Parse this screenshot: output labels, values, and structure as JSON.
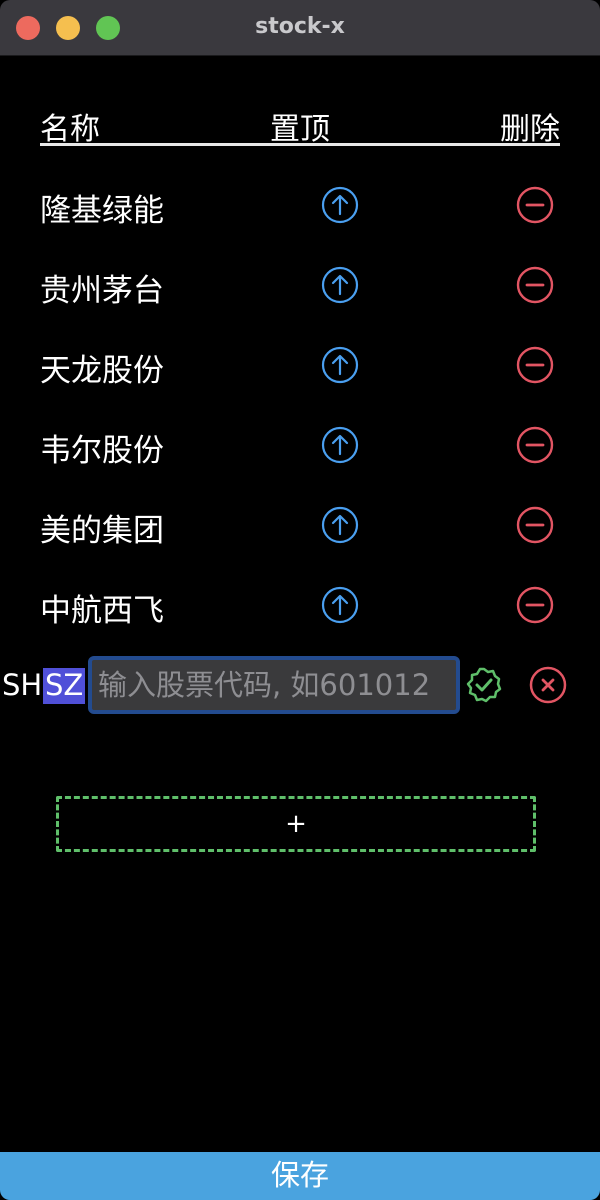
{
  "window": {
    "title": "stock-x"
  },
  "header": {
    "name_label": "名称",
    "pin_label": "置顶",
    "delete_label": "删除"
  },
  "stocks": [
    {
      "name": "隆基绿能"
    },
    {
      "name": "贵州茅台"
    },
    {
      "name": "天龙股份"
    },
    {
      "name": "韦尔股份"
    },
    {
      "name": "美的集团"
    },
    {
      "name": "中航西飞"
    }
  ],
  "edit_row": {
    "exchange_sh": "SH",
    "exchange_sz": "SZ",
    "code_value": "",
    "code_placeholder": "输入股票代码, 如601012"
  },
  "add_button": {
    "label": "+"
  },
  "save_button": {
    "label": "保存"
  },
  "colors": {
    "pin": "#4a9ff0",
    "delete": "#e25563",
    "confirm": "#5fbf6a",
    "save_bar": "#4aa3df",
    "selected": "#5050d8"
  }
}
